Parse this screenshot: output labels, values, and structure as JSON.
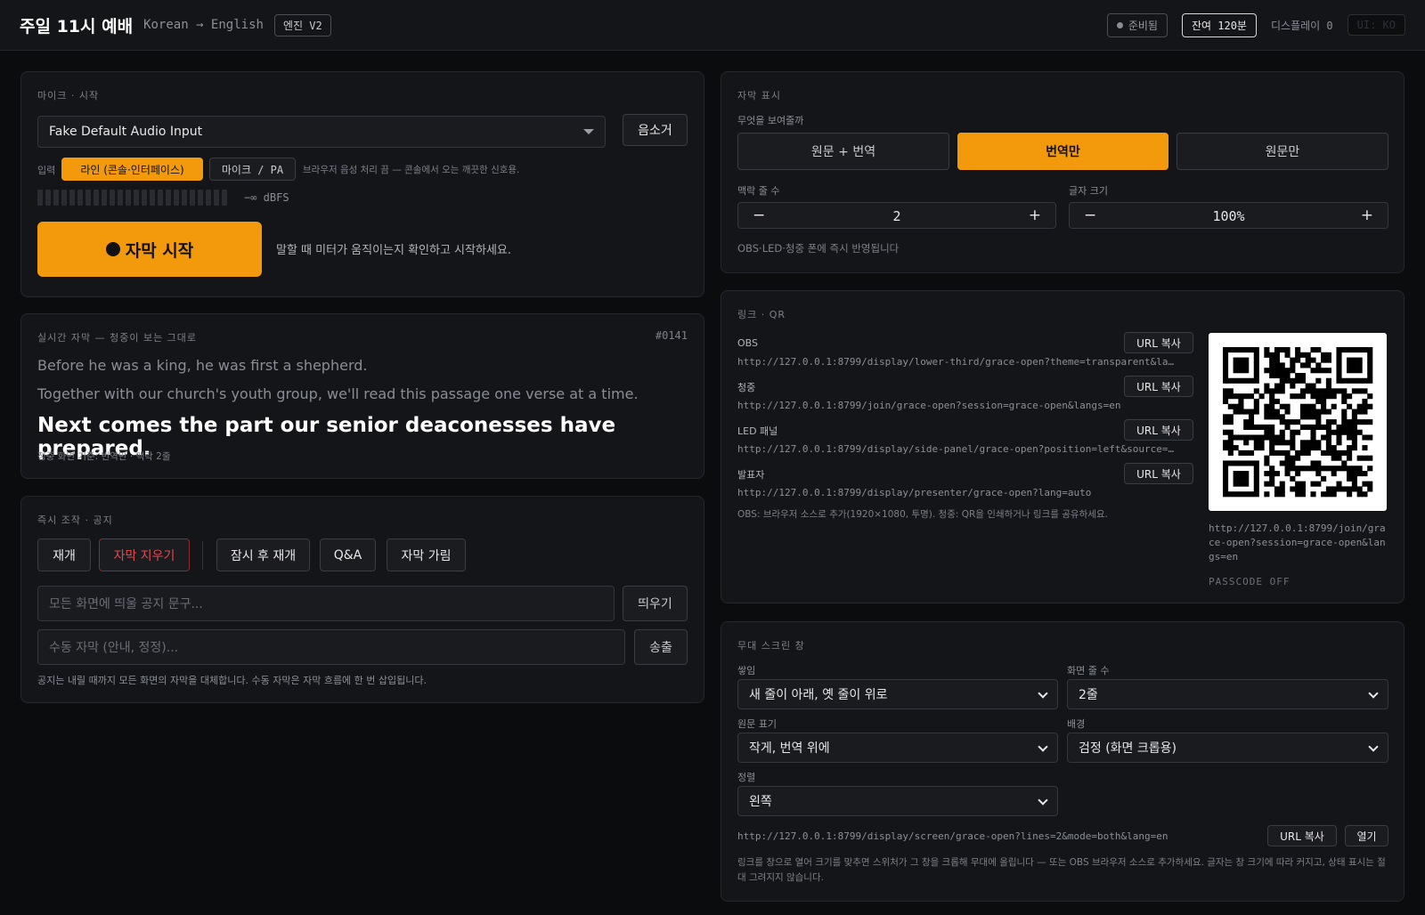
{
  "header": {
    "title": "주일 11시 예배",
    "lang": "Korean → English",
    "engine": "엔진 V2",
    "status": "준비됨",
    "remaining": "잔여 120분",
    "display_count": "디스플레이 0",
    "ui_lang": "UI: KO"
  },
  "mic": {
    "label": "마이크 · 시작",
    "device": "Fake Default Audio Input",
    "mute_label": "음소거",
    "input_label": "입력",
    "input_line": "라인 (콘솔·인터페이스)",
    "input_mic": "마이크 / PA",
    "input_hint": "브라우저 음성 처리 끔 — 콘솔에서 오는 깨끗한 신호용.",
    "meter_text": "−∞ dBFS",
    "meter_level": 0,
    "start_label": "자막 시작",
    "start_hint": "말할 때 미터가 움직이는지 확인하고 시작하세요."
  },
  "live": {
    "label": "실시간 자막 — 청중이 보는 그대로",
    "number": "#0141",
    "lines": [
      "Before he was a king, he was first a shepherd.",
      "Together with our church's youth group, we'll read this passage one verse at a time."
    ],
    "current": "Next comes the part our senior deaconesses have prepared.",
    "footer": "청중 화면 기준: 번역만 · 맥락 2줄"
  },
  "controls": {
    "label": "즉시 조작 · 공지",
    "resume": "재개",
    "clear": "자막 지우기",
    "pause_resume": "잠시 후 재개",
    "qa": "Q&A",
    "hide": "자막 가림",
    "notice_placeholder": "모든 화면에 띄울 공지 문구...",
    "notice_button": "띄우기",
    "manual_placeholder": "수동 자막 (안내, 정정)...",
    "manual_button": "송출",
    "hint": "공지는 내릴 때까지 모든 화면의 자막을 대체합니다. 수동 자막은 자막 흐름에 한 번 삽입됩니다."
  },
  "display": {
    "label": "자막 표시",
    "what_label": "무엇을 보여줄까",
    "modes": [
      "원문 + 번역",
      "번역만",
      "원문만"
    ],
    "context_label": "맥락 줄 수",
    "context_value": "2",
    "size_label": "글자 크기",
    "size_value": "100%",
    "minus": "−",
    "plus": "+",
    "hint": "OBS·LED·청중 폰에 즉시 반영됩니다"
  },
  "links": {
    "label": "링크 · QR",
    "copy_label": "URL 복사",
    "items": [
      {
        "name": "OBS",
        "url": "http://127.0.0.1:8799/display/lower-third/grace-open?theme=transparent&la…"
      },
      {
        "name": "청중",
        "url": "http://127.0.0.1:8799/join/grace-open?session=grace-open&langs=en"
      },
      {
        "name": "LED 패널",
        "url": "http://127.0.0.1:8799/display/side-panel/grace-open?position=left&source=…"
      },
      {
        "name": "발표자",
        "url": "http://127.0.0.1:8799/display/presenter/grace-open?lang=auto"
      }
    ],
    "hint": "OBS: 브라우저 소스로 추가(1920×1080, 투명). 청중: QR을 인쇄하거나 링크를 공유하세요.",
    "qr_url": "http://127.0.0.1:8799/join/grace-open?session=grace-open&langs=en",
    "passcode": "PASSCODE OFF"
  },
  "stage": {
    "label": "무대 스크린 창",
    "stack_label": "쌓임",
    "stack_value": "새 줄이 아래, 옛 줄이 위로",
    "lines_label": "화면 줄 수",
    "lines_value": "2줄",
    "source_label": "원문 표기",
    "source_value": "작게, 번역 위에",
    "bg_label": "배경",
    "bg_value": "검정 (화면 크롭용)",
    "align_label": "정렬",
    "align_value": "왼쪽",
    "url": "http://127.0.0.1:8799/display/screen/grace-open?lines=2&mode=both&lang=en",
    "copy_label": "URL 복사",
    "open_label": "열기",
    "hint": "링크를 창으로 열어 크기를 맞추면 스위처가 그 창을 크롭해 무대에 올립니다 — 또는 OBS 브라우저 소스로 추가하세요. 글자는 창 크기에 따라 커지고, 상태 표시는 절대 그려지지 않습니다."
  },
  "colors": {
    "accent": "#f29a0c",
    "danger": "#e5484d"
  }
}
